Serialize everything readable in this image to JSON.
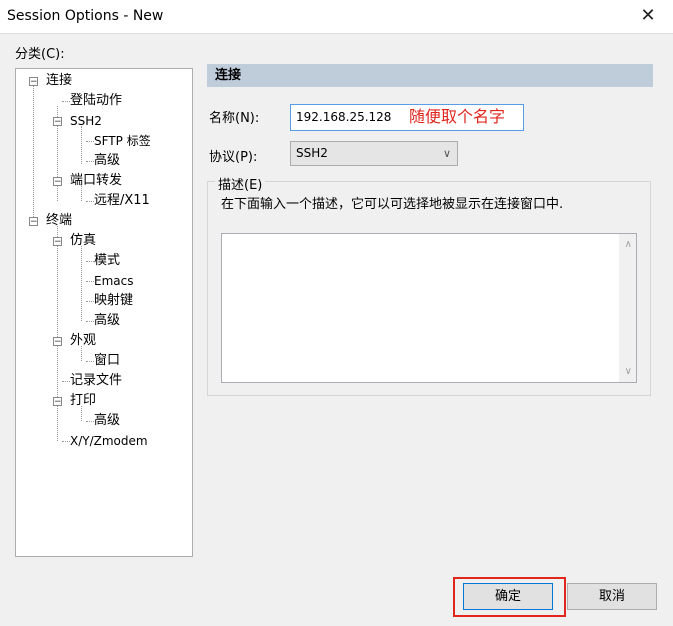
{
  "window": {
    "title": "Session Options - New",
    "close": "✕"
  },
  "category": {
    "label": "分类(C):"
  },
  "tree": {
    "lian_jie": "连接",
    "deng_lu": "登陆动作",
    "ssh2": "SSH2",
    "sftp": "SFTP 标签",
    "ssh2_gaoji": "高级",
    "port_fwd": "端口转发",
    "remote_x11": "远程/X11",
    "terminal": "终端",
    "emulation": "仿真",
    "mode": "模式",
    "emacs": "Emacs",
    "mapkeys": "映射键",
    "emu_gaoji": "高级",
    "appearance": "外观",
    "window": "窗口",
    "logfile": "记录文件",
    "print": "打印",
    "print_gaoji": "高级",
    "xyz": "X/Y/Zmodem"
  },
  "panel": {
    "header": "连接",
    "name_label": "名称(N):",
    "name_value": "192.168.25.128",
    "annotation": "随便取个名字",
    "protocol_label": "协议(P):",
    "protocol_value": "SSH2",
    "desc_group": "描述(E)",
    "desc_hint": "在下面输入一个描述，它可以可选择地被显示在连接窗口中."
  },
  "buttons": {
    "ok": "确定",
    "cancel": "取消"
  },
  "colors": {
    "header_bg": "#bfcddb",
    "highlight": "#e0261d"
  }
}
